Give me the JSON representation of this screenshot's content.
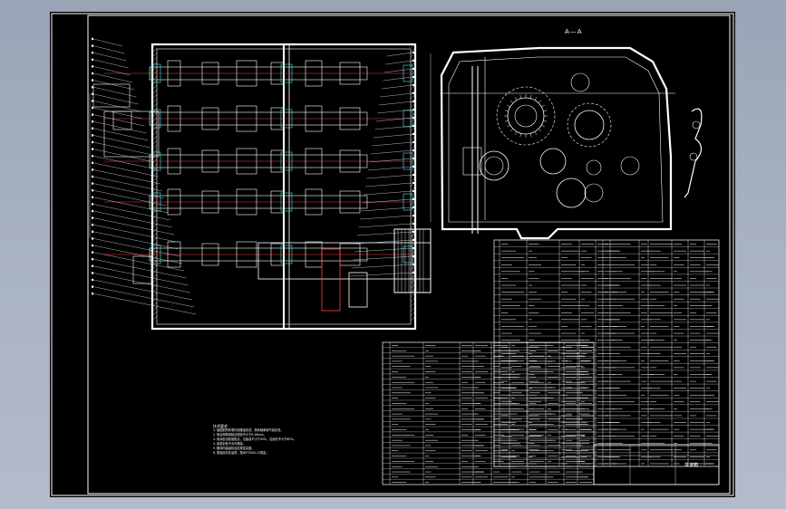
{
  "drawing": {
    "section_label": "A—A",
    "title_block_name": "变速箱",
    "notes_title": "技术要求",
    "notes": [
      "1. 装配前所有零件用煤油清洗，滚动轴承用汽油清洗。",
      "2. 啮合侧隙用铅丝检验不小于0.16mm。",
      "3. 用涂色法检验斑点，沿齿高不小于45%，沿齿长不小于60%。",
      "4. 各密封处不允许漏油。",
      "5. 箱体内装齿轮油至规定高度。",
      "6. 表面涂灰色油漆，按JB/T5000.12规定。"
    ]
  },
  "colors": {
    "background": "#a9b2c2",
    "sheet": "#000000",
    "line": "#ffffff",
    "center_line": "#ff3b3b",
    "bearing": "#39c6d6",
    "hatch": "#cfcfcf"
  }
}
